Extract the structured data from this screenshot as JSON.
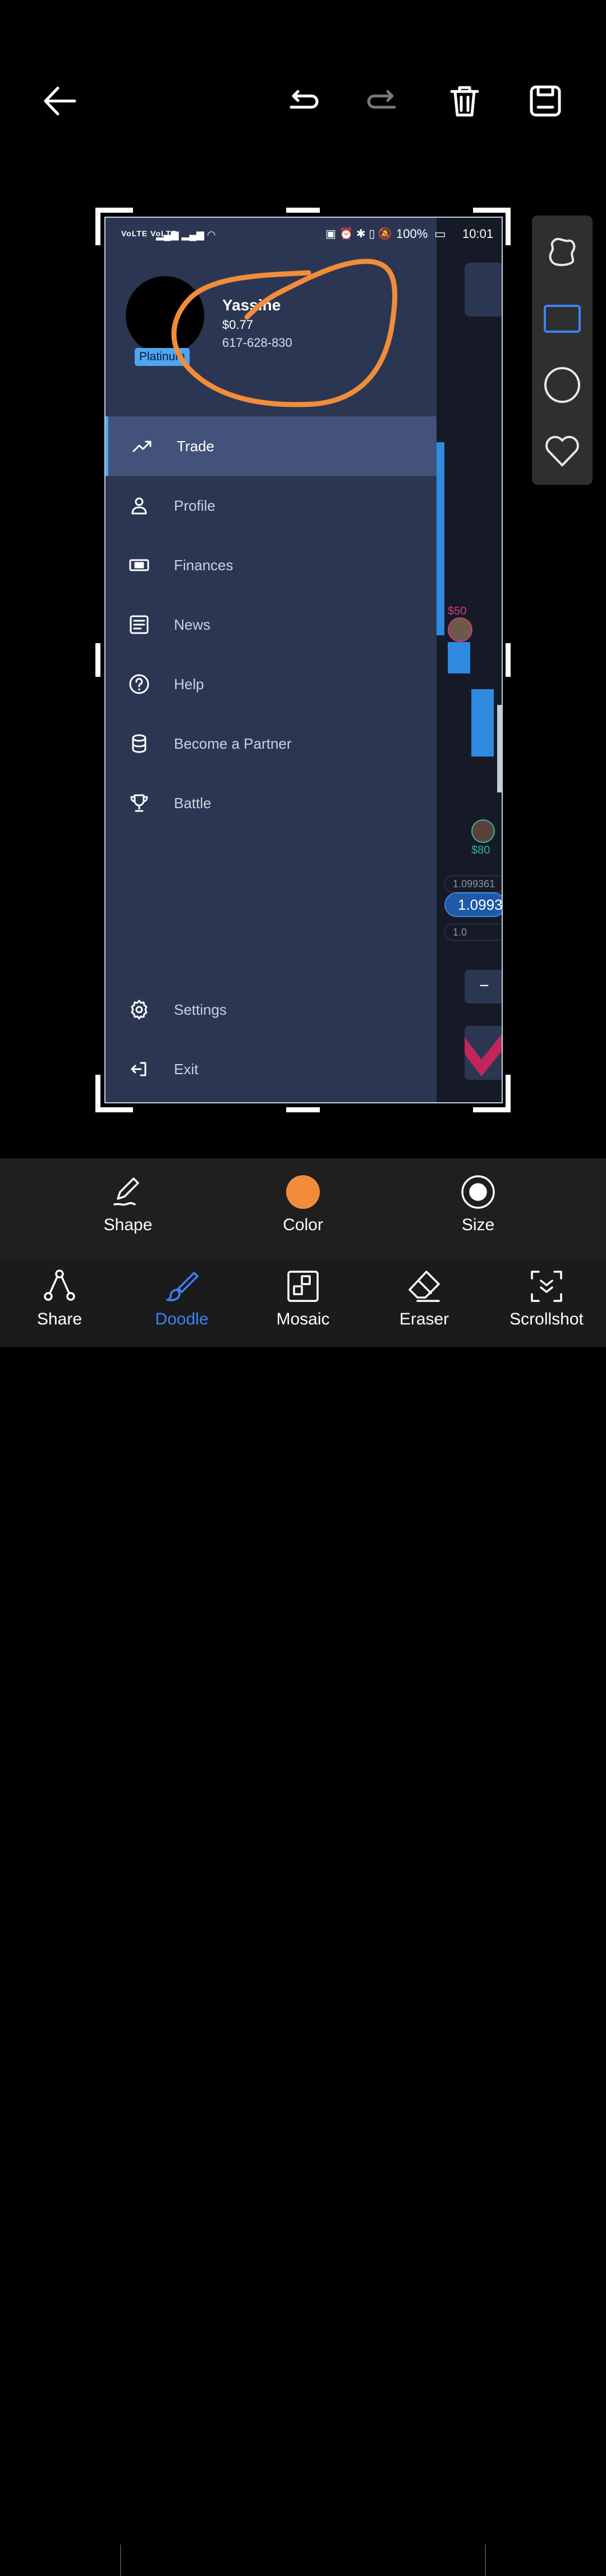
{
  "status_bar": {
    "signal": "VoLTE VoLTE",
    "battery": "100%",
    "time": "10:01"
  },
  "user": {
    "name": "Yassine",
    "balance": "$0.77",
    "id": "617-628-830",
    "tier": "Platinum"
  },
  "menu": [
    {
      "label": "Trade",
      "icon": "trending-up-icon",
      "active": true
    },
    {
      "label": "Profile",
      "icon": "person-icon"
    },
    {
      "label": "Finances",
      "icon": "cash-icon"
    },
    {
      "label": "News",
      "icon": "news-icon"
    },
    {
      "label": "Help",
      "icon": "help-icon"
    },
    {
      "label": "Become a Partner",
      "icon": "database-icon"
    },
    {
      "label": "Battle",
      "icon": "trophy-icon"
    }
  ],
  "menu_bottom": [
    {
      "label": "Settings",
      "icon": "gear-icon"
    },
    {
      "label": "Exit",
      "icon": "exit-icon"
    }
  ],
  "chart": {
    "bet1": "$50",
    "bet2": "$80",
    "price_small": "1.099361",
    "price_main": "1.0993",
    "price_low": "1.0",
    "minus": "−"
  },
  "sub_tools": [
    {
      "label": "Shape",
      "icon": "pen-shape-icon"
    },
    {
      "label": "Color",
      "icon": "color-dot-icon"
    },
    {
      "label": "Size",
      "icon": "size-icon"
    }
  ],
  "main_tools": [
    {
      "label": "Share",
      "icon": "share-icon"
    },
    {
      "label": "Doodle",
      "icon": "brush-icon",
      "active": true
    },
    {
      "label": "Mosaic",
      "icon": "mosaic-icon"
    },
    {
      "label": "Eraser",
      "icon": "eraser-icon"
    },
    {
      "label": "Scrollshot",
      "icon": "scrollshot-icon"
    }
  ],
  "colors": {
    "accent": "#3b82f6",
    "doodle": "#f28c3a",
    "drawer": "#2b3752",
    "active_row": "#43527a",
    "badge": "#4ea6f2"
  }
}
